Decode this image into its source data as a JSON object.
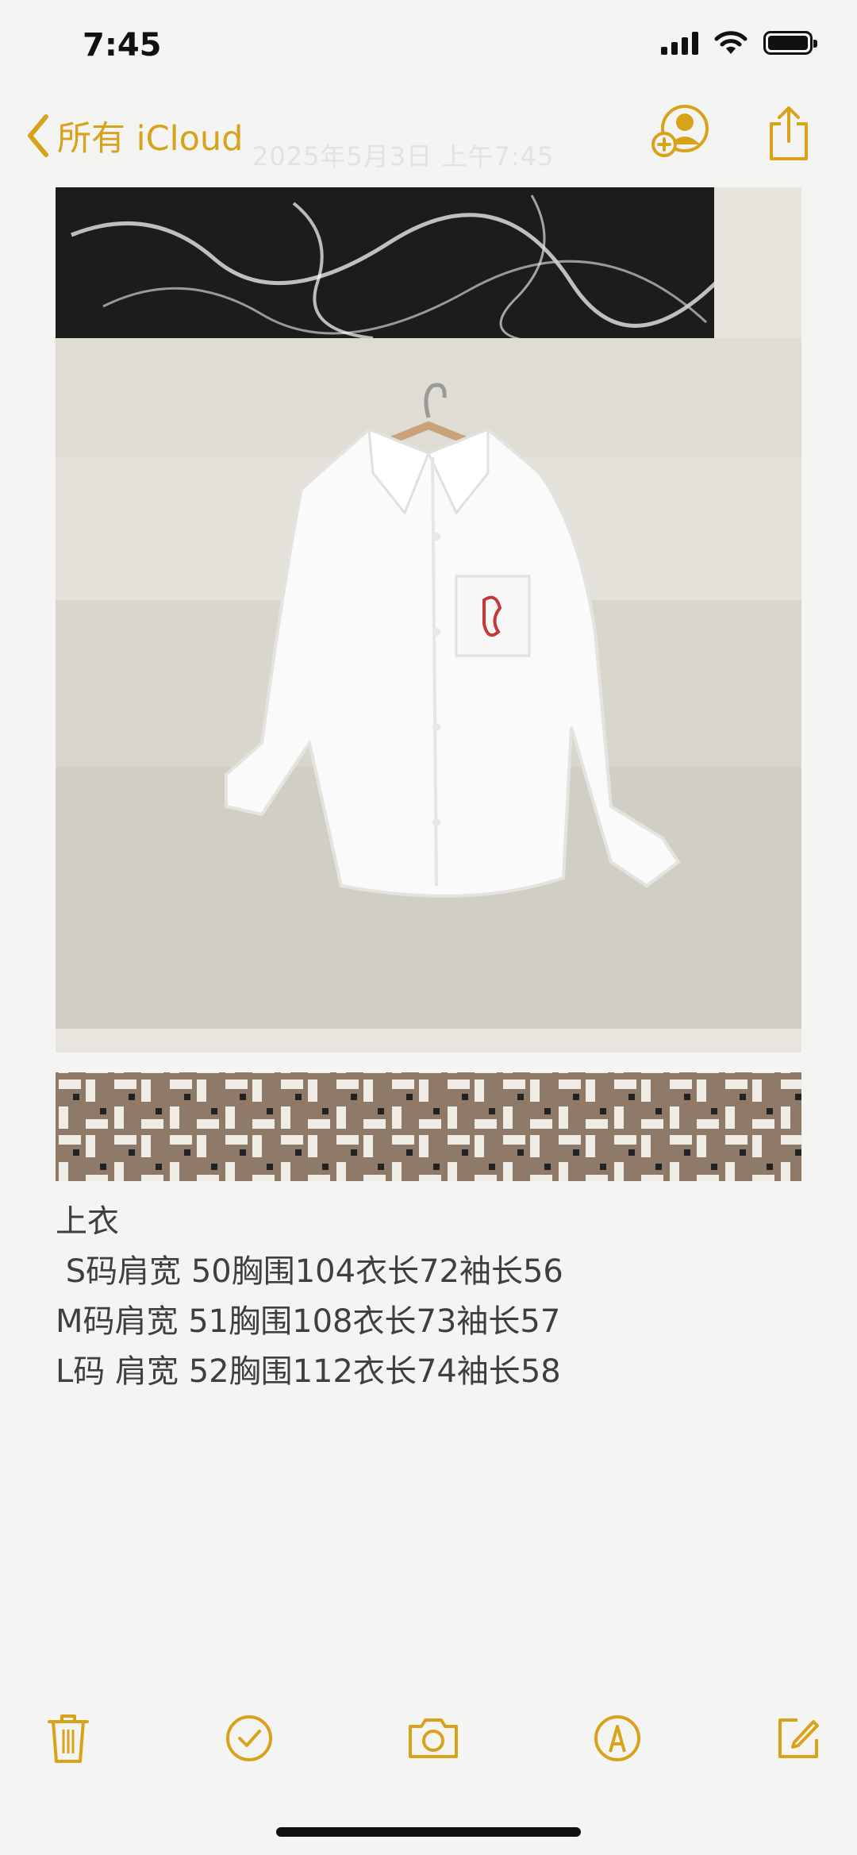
{
  "status_bar": {
    "time": "7:45"
  },
  "nav": {
    "back_label": "所有 iCloud",
    "timestamp": "2025年5月3日 上午7:45"
  },
  "note": {
    "lines": [
      "上衣",
      " S码肩宽 50胸围104衣长72袖长56",
      "M码肩宽 51胸围108衣长73袖长57",
      "L码 肩宽 52胸围112衣长74袖长58"
    ]
  },
  "colors": {
    "accent": "#d9a21b",
    "background": "#f4f4f3",
    "text": "#3f3f3f"
  },
  "toolbar_icons": [
    "trash-icon",
    "checklist-icon",
    "camera-icon",
    "markup-icon",
    "compose-icon"
  ]
}
